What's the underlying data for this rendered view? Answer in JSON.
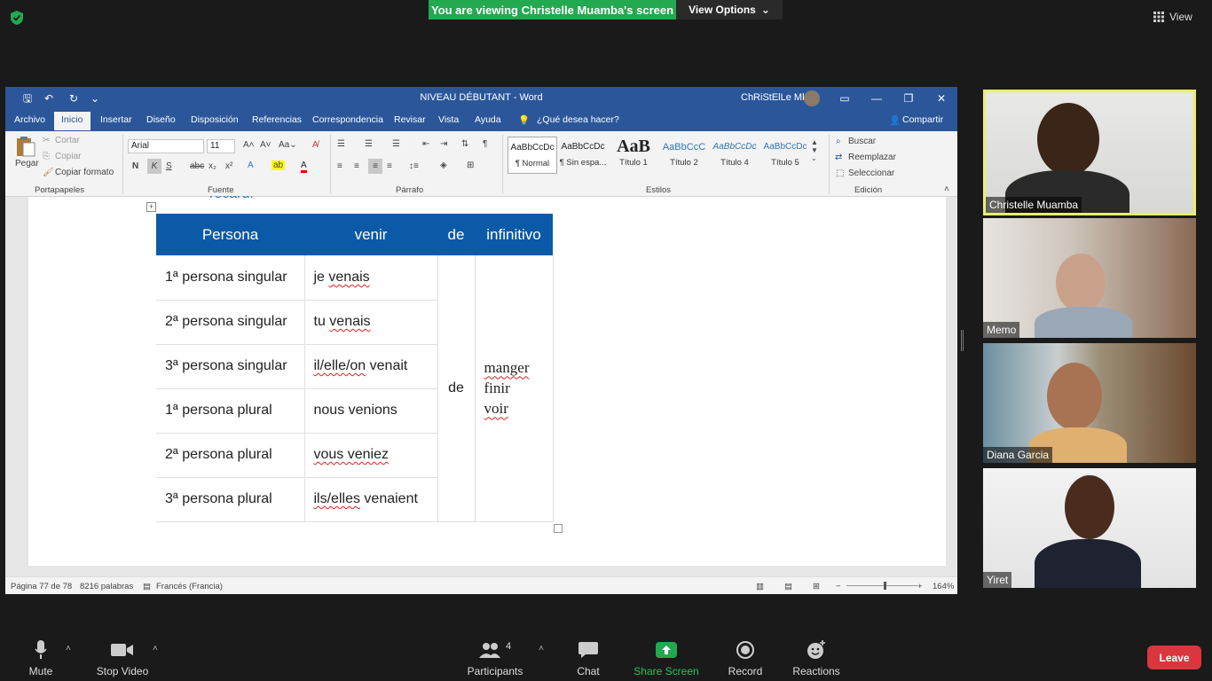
{
  "zoom": {
    "banner": "You are viewing Christelle Muamba's screen",
    "view_options": "View Options",
    "view": "View"
  },
  "word": {
    "title": "NIVEAU DÉBUTANT  -  Word",
    "user": "ChRiStElLe Mk",
    "tabs": [
      "Archivo",
      "Inicio",
      "Insertar",
      "Diseño",
      "Disposición",
      "Referencias",
      "Correspondencia",
      "Revisar",
      "Vista",
      "Ayuda"
    ],
    "tell_me": "¿Qué desea hacer?",
    "share": "Compartir",
    "ribbon": {
      "paste": "Pegar",
      "cut": "Cortar",
      "copy": "Copiar",
      "format_painter": "Copiar formato",
      "clipboard_label": "Portapapeles",
      "font_name": "Arial",
      "font_size": "11",
      "font_label": "Fuente",
      "paragraph_label": "Párrafo",
      "styles_label": "Estilos",
      "editing_label": "Edición",
      "find": "Buscar",
      "replace": "Reemplazar",
      "select": "Seleccionar",
      "styles": [
        {
          "sample": "AaBbCcDc",
          "name": "¶ Normal"
        },
        {
          "sample": "AaBbCcDc",
          "name": "¶ Sin espa..."
        },
        {
          "sample": "AaB",
          "name": "Título 1"
        },
        {
          "sample": "AaBbCcC",
          "name": "Título 2"
        },
        {
          "sample": "AaBbCcDc",
          "name": "Título 4"
        },
        {
          "sample": "AaBbCcDc",
          "name": "Título 5"
        }
      ]
    },
    "document": {
      "partial_heading": "recard:",
      "headers": [
        "Persona",
        "venir",
        "de",
        "infinitivo"
      ],
      "rows": [
        {
          "persona": "1ª persona singular",
          "venir": "je venais"
        },
        {
          "persona": "2ª persona singular",
          "venir": "tu venais"
        },
        {
          "persona": "3ª persona singular",
          "venir": "il/elle/on venait"
        },
        {
          "persona": "1ª persona plural",
          "venir": "nous venions"
        },
        {
          "persona": "2ª persona plural",
          "venir": "vous veniez"
        },
        {
          "persona": "3ª persona plural",
          "venir": "ils/elles venaient"
        }
      ],
      "de": "de",
      "infinitives": [
        "manger",
        "finir",
        "voir"
      ]
    },
    "status": {
      "page": "Página 77 de 78",
      "words": "8216 palabras",
      "language": "Francés (Francia)",
      "zoom": "164%"
    }
  },
  "participants_video": [
    {
      "name": "Christelle Muamba",
      "active": true
    },
    {
      "name": "Memo",
      "active": false
    },
    {
      "name": "Diana Garcia",
      "active": false
    },
    {
      "name": "Yiret",
      "active": false
    }
  ],
  "toolbar": {
    "mute": "Mute",
    "stop_video": "Stop Video",
    "participants": "Participants",
    "participant_count": "4",
    "chat": "Chat",
    "share_screen": "Share Screen",
    "record": "Record",
    "reactions": "Reactions",
    "leave": "Leave"
  },
  "colors": {
    "word_blue": "#2b579a",
    "table_header": "#0a5aa8",
    "zoom_green": "#23a94f",
    "leave_red": "#d9363e",
    "active_speaker": "#e8f06a"
  }
}
